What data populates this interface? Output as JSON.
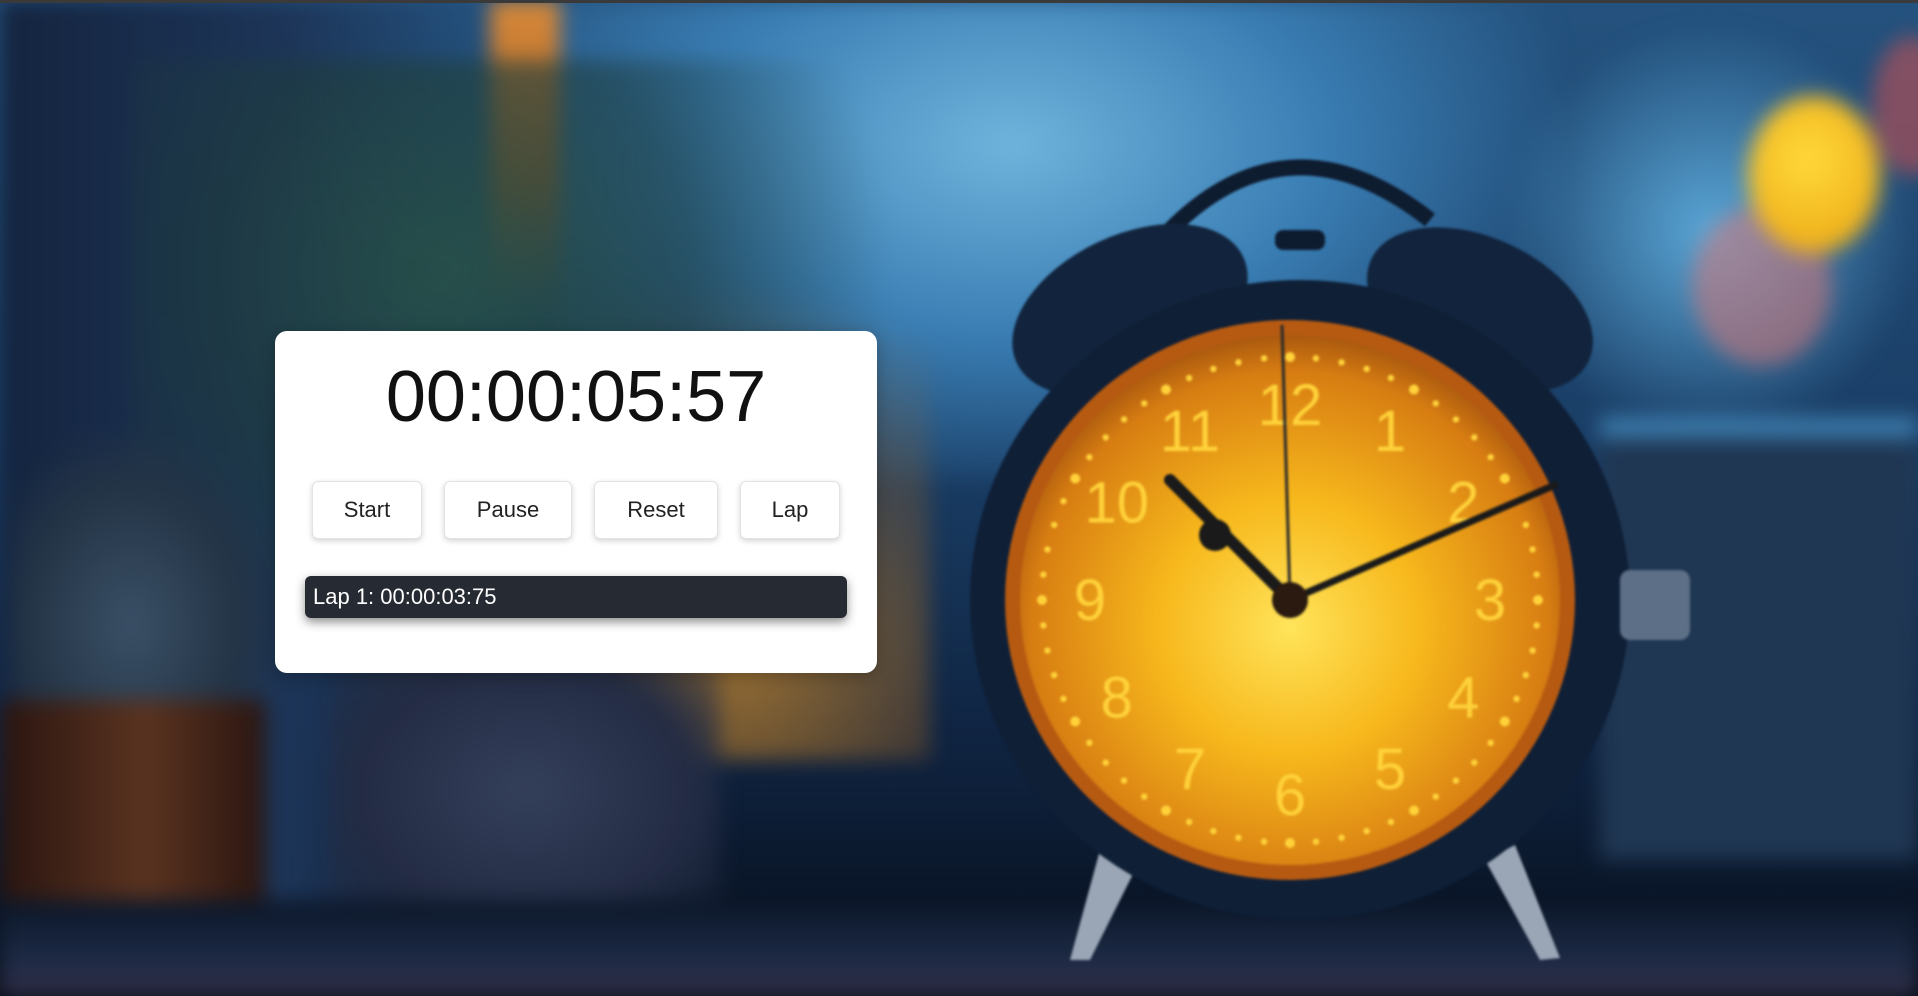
{
  "stopwatch": {
    "display": "00:00:05:57",
    "buttons": {
      "start": "Start",
      "pause": "Pause",
      "reset": "Reset",
      "lap": "Lap"
    },
    "laps": [
      "Lap 1: 00:00:03:75"
    ]
  },
  "background": {
    "clock_numerals": [
      "12",
      "1",
      "2",
      "3",
      "4",
      "5",
      "6",
      "7",
      "8",
      "9",
      "10",
      "11"
    ],
    "colors": {
      "clock_face": "#f2a516",
      "clock_numerals": "#ffd23a",
      "clock_body": "#13253f"
    }
  }
}
